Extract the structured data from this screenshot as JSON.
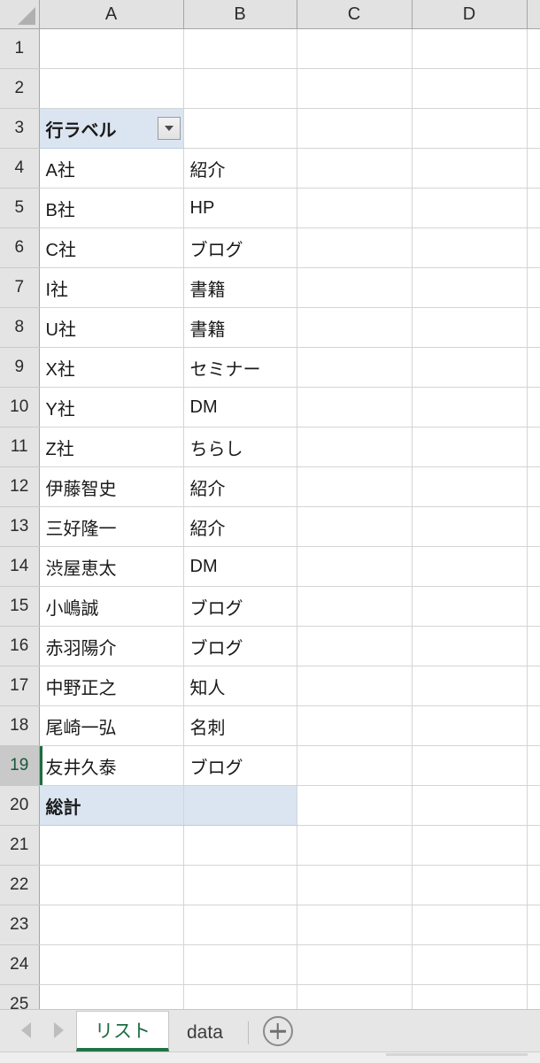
{
  "app": {
    "type": "spreadsheet"
  },
  "grid": {
    "corner_icon": "select-all-icon",
    "column_headers": [
      "A",
      "B",
      "C",
      "D"
    ],
    "row_numbers": [
      "1",
      "2",
      "3",
      "4",
      "5",
      "6",
      "7",
      "8",
      "9",
      "10",
      "11",
      "12",
      "13",
      "14",
      "15",
      "16",
      "17",
      "18",
      "19",
      "20",
      "21",
      "22",
      "23",
      "24",
      "25"
    ],
    "active_row": "19",
    "active_cell": "A19",
    "pivot": {
      "row_label_header": "行ラベル",
      "filter_icon": "filter-dropdown-icon",
      "grand_total_label": "総計"
    },
    "rows": [
      {
        "row": "1",
        "a": "",
        "b": ""
      },
      {
        "row": "2",
        "a": "",
        "b": ""
      },
      {
        "row": "3",
        "a": "行ラベル",
        "b": ""
      },
      {
        "row": "4",
        "a": "A社",
        "b": "紹介"
      },
      {
        "row": "5",
        "a": "B社",
        "b": "HP"
      },
      {
        "row": "6",
        "a": "C社",
        "b": "ブログ"
      },
      {
        "row": "7",
        "a": "I社",
        "b": "書籍"
      },
      {
        "row": "8",
        "a": "U社",
        "b": "書籍"
      },
      {
        "row": "9",
        "a": "X社",
        "b": "セミナー"
      },
      {
        "row": "10",
        "a": "Y社",
        "b": "DM"
      },
      {
        "row": "11",
        "a": "Z社",
        "b": "ちらし"
      },
      {
        "row": "12",
        "a": "伊藤智史",
        "b": "紹介"
      },
      {
        "row": "13",
        "a": "三好隆一",
        "b": "紹介"
      },
      {
        "row": "14",
        "a": "渋屋恵太",
        "b": "DM"
      },
      {
        "row": "15",
        "a": "小嶋誠",
        "b": "ブログ"
      },
      {
        "row": "16",
        "a": "赤羽陽介",
        "b": "ブログ"
      },
      {
        "row": "17",
        "a": "中野正之",
        "b": "知人"
      },
      {
        "row": "18",
        "a": "尾崎一弘",
        "b": "名刺"
      },
      {
        "row": "19",
        "a": "友井久泰",
        "b": "ブログ"
      },
      {
        "row": "20",
        "a": "総計",
        "b": ""
      },
      {
        "row": "21",
        "a": "",
        "b": ""
      },
      {
        "row": "22",
        "a": "",
        "b": ""
      },
      {
        "row": "23",
        "a": "",
        "b": ""
      },
      {
        "row": "24",
        "a": "",
        "b": ""
      },
      {
        "row": "25",
        "a": "",
        "b": ""
      }
    ]
  },
  "tabbar": {
    "prev_icon": "nav-prev-icon",
    "next_icon": "nav-next-icon",
    "add_icon": "add-sheet-icon",
    "tabs": [
      {
        "label": "リスト",
        "active": true
      },
      {
        "label": "data",
        "active": false
      }
    ]
  },
  "colors": {
    "excel_green": "#217346",
    "pivot_header_fill": "#dbe5f1",
    "header_fill": "#e2e2e2",
    "gridline": "#d4d4d4",
    "selection_green": "#1e6b42"
  }
}
